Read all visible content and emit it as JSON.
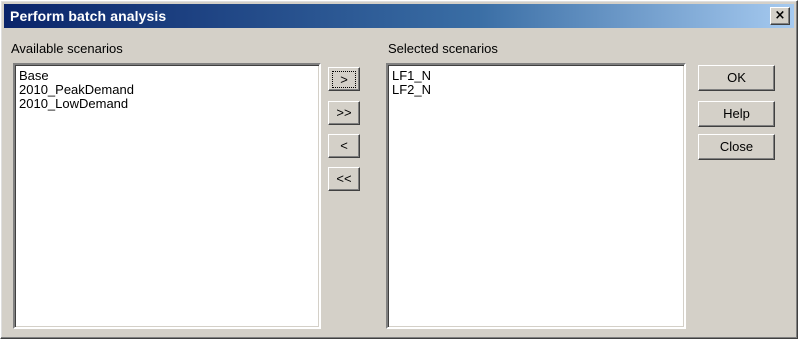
{
  "window": {
    "title": "Perform batch analysis",
    "close_glyph": "×"
  },
  "available": {
    "label": "Available scenarios",
    "items": [
      "Base",
      "2010_PeakDemand",
      "2010_LowDemand"
    ]
  },
  "selected": {
    "label": "Selected scenarios",
    "items": [
      "LF1_N",
      "LF2_N"
    ]
  },
  "transfer_buttons": {
    "add_one": ">",
    "add_all": ">>",
    "remove_one": "<",
    "remove_all": "<<"
  },
  "action_buttons": {
    "ok": "OK",
    "help": "Help",
    "close": "Close"
  }
}
